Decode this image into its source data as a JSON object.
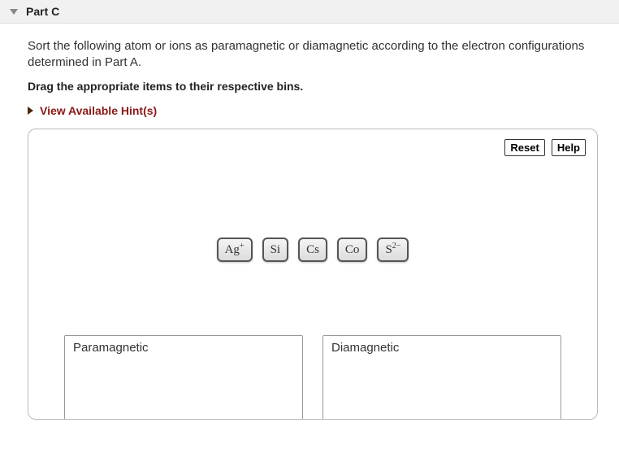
{
  "header": {
    "title": "Part C"
  },
  "prompt": "Sort the following atom or ions as paramagnetic or diamagnetic according to the electron configurations determined in Part A.",
  "instruction": "Drag the appropriate items to their respective bins.",
  "hints_label": "View Available Hint(s)",
  "toolbar": {
    "reset": "Reset",
    "help": "Help"
  },
  "items": [
    {
      "base": "Ag",
      "sup": "+"
    },
    {
      "base": "Si",
      "sup": ""
    },
    {
      "base": "Cs",
      "sup": ""
    },
    {
      "base": "Co",
      "sup": ""
    },
    {
      "base": "S",
      "sup": "2−"
    }
  ],
  "bins": {
    "left": "Paramagnetic",
    "right": "Diamagnetic"
  }
}
